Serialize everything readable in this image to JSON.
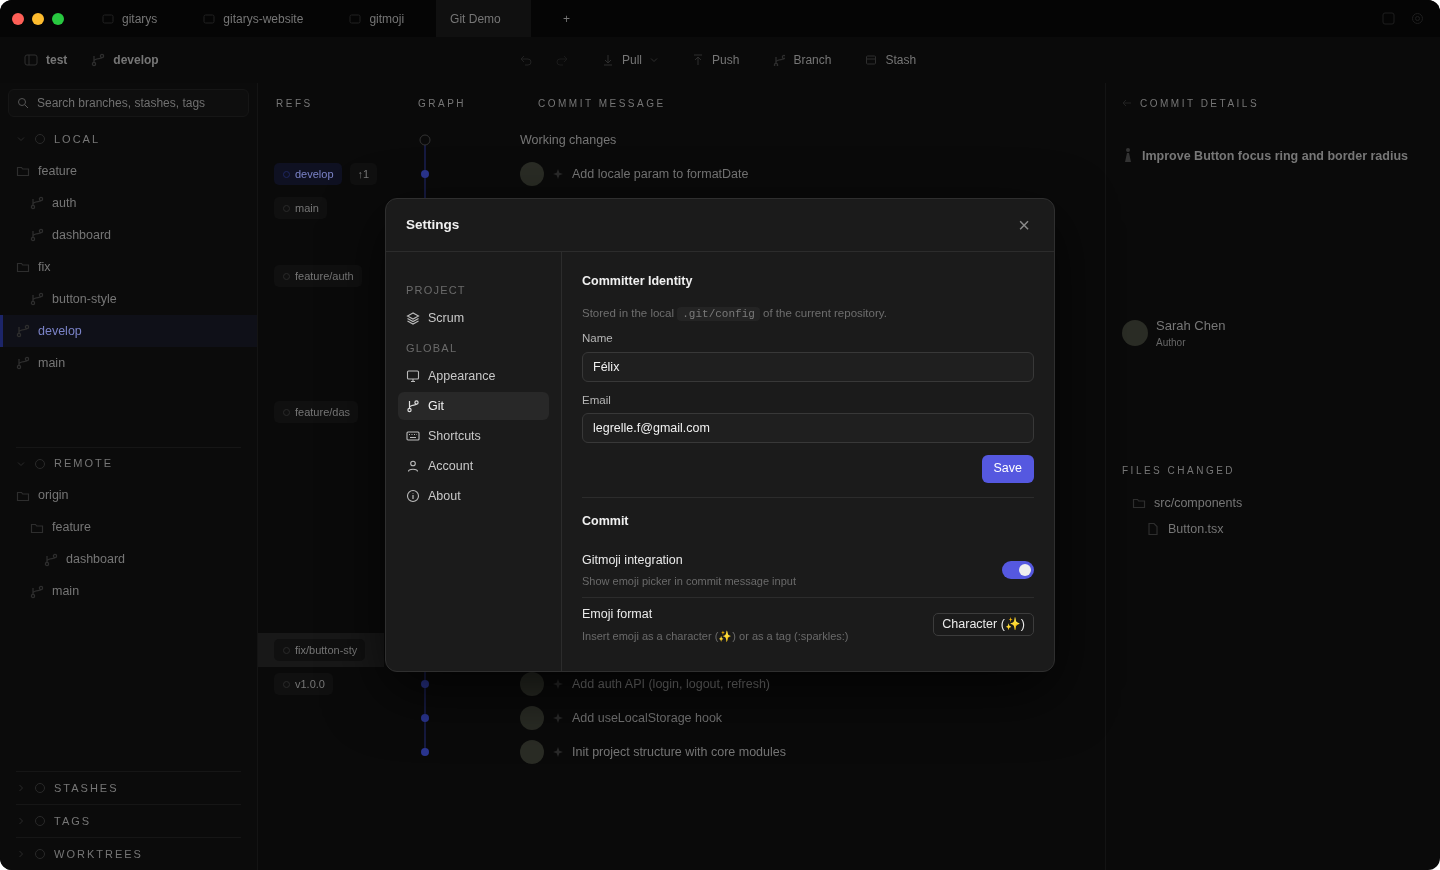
{
  "window": {
    "tabs": [
      {
        "label": "gitarys",
        "selected": false
      },
      {
        "label": "gitarys-website",
        "selected": false
      },
      {
        "label": "gitmoji",
        "selected": false
      },
      {
        "label": "Git Demo",
        "selected": true
      }
    ],
    "new_tab": "+"
  },
  "toolbar": {
    "repo": "test",
    "branch": "develop",
    "actions": [
      "Pull",
      "Push",
      "Branch",
      "Stash"
    ]
  },
  "sidebar": {
    "search": {
      "placeholder": "Search branches, stashes, tags"
    },
    "sections": [
      {
        "title": "LOCAL",
        "expanded": true,
        "children": [
          {
            "label": "feature",
            "kind": "folder",
            "selected": false,
            "children": [
              {
                "label": "auth",
                "kind": "branch",
                "selected": false
              },
              {
                "label": "dashboard",
                "kind": "branch",
                "selected": false
              }
            ]
          },
          {
            "label": "fix",
            "kind": "folder",
            "selected": false,
            "children": [
              {
                "label": "button-style",
                "kind": "branch",
                "selected": false
              }
            ]
          },
          {
            "label": "develop",
            "kind": "branch",
            "selected": true
          },
          {
            "label": "main",
            "kind": "branch",
            "selected": false
          }
        ]
      },
      {
        "title": "REMOTE",
        "expanded": true,
        "children": [
          {
            "label": "origin",
            "kind": "folder",
            "selected": false,
            "children": [
              {
                "label": "feature",
                "kind": "folder",
                "selected": false,
                "children": [
                  {
                    "label": "dashboard",
                    "kind": "branch",
                    "selected": false
                  }
                ]
              },
              {
                "label": "main",
                "kind": "branch",
                "selected": false
              }
            ]
          }
        ]
      },
      {
        "title": "STASHES",
        "expanded": false
      },
      {
        "title": "TAGS",
        "expanded": false
      },
      {
        "title": "WORKTREES",
        "expanded": false
      }
    ]
  },
  "history": {
    "columns": [
      "REFS",
      "GRAPH",
      "COMMIT MESSAGE"
    ],
    "rows": [
      {
        "kind": "working",
        "message": "Working changes",
        "selected": false
      },
      {
        "kind": "commit",
        "refs": [
          {
            "label": "develop",
            "kind": "head"
          }
        ],
        "ahead": "↑1",
        "message": "Add locale param to formatDate",
        "selected": false
      },
      {
        "refs": [
          {
            "label": "main",
            "kind": "branch"
          }
        ],
        "selected": false
      },
      {
        "refs": [
          {
            "label": "feature/auth",
            "kind": "branch"
          }
        ],
        "selected": false
      },
      {
        "refs": [
          {
            "label": "feature/das",
            "kind": "branch"
          }
        ],
        "selected": false
      },
      {
        "refs": [
          {
            "label": "fix/button-sty",
            "kind": "branch"
          }
        ],
        "selected": true
      },
      {
        "kind": "commit",
        "refs": [
          {
            "label": "v1.0.0",
            "kind": "tag"
          }
        ],
        "message": "Add auth API (login, logout, refresh)",
        "selected": false
      },
      {
        "kind": "commit",
        "message": "Add useLocalStorage hook",
        "selected": false
      },
      {
        "kind": "commit",
        "message": "Init project structure with core modules",
        "selected": false
      }
    ]
  },
  "details": {
    "title": "COMMIT DETAILS",
    "subject": "Improve Button focus ring and border radius",
    "author": "Sarah Chen",
    "author_role": "Author",
    "files_title": "FILES CHANGED",
    "files": [
      {
        "label": "src/components",
        "kind": "folder"
      },
      {
        "label": "Button.tsx",
        "kind": "file"
      }
    ]
  },
  "settings": {
    "title": "Settings",
    "close": "×",
    "nav": [
      {
        "kind": "heading",
        "label": "PROJECT"
      },
      {
        "kind": "item",
        "label": "Scrum",
        "selected": false
      },
      {
        "kind": "heading",
        "label": "GLOBAL"
      },
      {
        "kind": "item",
        "label": "Appearance",
        "selected": false
      },
      {
        "kind": "item",
        "label": "Git",
        "selected": true
      },
      {
        "kind": "item",
        "label": "Shortcuts",
        "selected": false
      },
      {
        "kind": "item",
        "label": "Account",
        "selected": false
      },
      {
        "kind": "item",
        "label": "About",
        "selected": false
      }
    ],
    "identity": {
      "title": "Committer Identity",
      "note_before": "Stored in the local",
      "note_code": ".git/config",
      "note_after": "of the current repository.",
      "fields": [
        {
          "label": "Name",
          "value": "Félix"
        },
        {
          "label": "Email",
          "value": "legrelle.f@gmail.com"
        }
      ],
      "save": "Save"
    },
    "commit": {
      "title": "Commit",
      "options": [
        {
          "kind": "toggle",
          "label": "Gitmoji integration",
          "hint": "Show emoji picker in commit message input",
          "on": true
        },
        {
          "kind": "select",
          "label": "Emoji format",
          "hint": "Insert emoji as a character (✨) or as a tag (:sparkles:)",
          "value": "Character (✨)"
        }
      ]
    }
  }
}
